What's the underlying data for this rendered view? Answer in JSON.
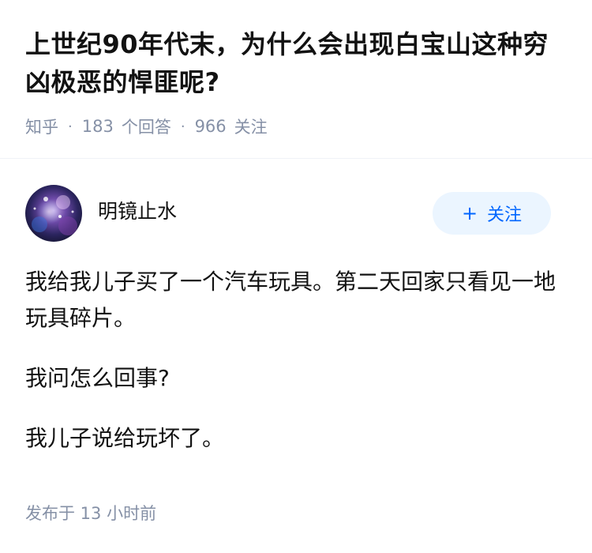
{
  "question": {
    "title": "上世纪90年代末，为什么会出现白宝山这种穷凶极恶的悍匪呢?",
    "meta": {
      "source": "知乎",
      "separator": "·",
      "answer_count": "183",
      "answer_label": "个回答",
      "follower_count": "966",
      "follower_label": "关注"
    }
  },
  "answer": {
    "author": {
      "name": "明镜止水"
    },
    "follow_button": {
      "icon": "+",
      "label": "关注"
    },
    "paragraphs": [
      "我给我儿子买了一个汽车玩具。第二天回家只看见一地玩具碎片。",
      "我问怎么回事?",
      "我儿子说给玩坏了。"
    ],
    "publish_time": "发布于 13 小时前"
  },
  "colors": {
    "accent": "#0066ff",
    "accent_bg": "#ebf5ff",
    "meta_text": "#8590a6",
    "main_text": "#121212"
  }
}
